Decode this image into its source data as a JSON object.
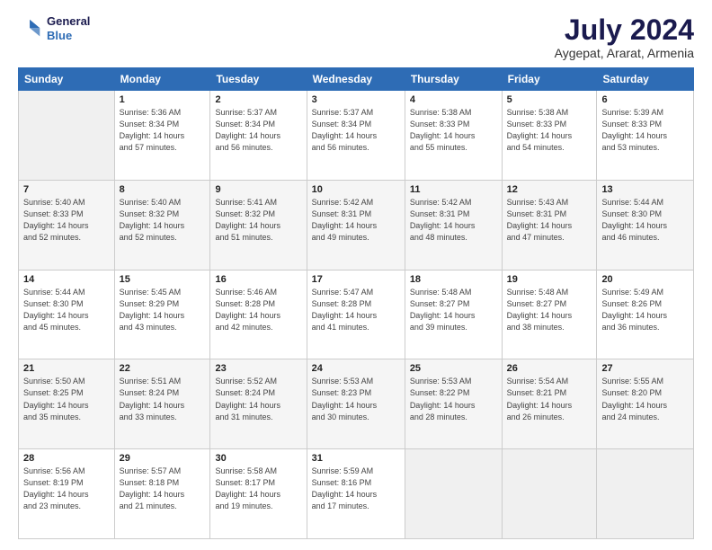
{
  "header": {
    "logo": {
      "line1": "General",
      "line2": "Blue"
    },
    "title": "July 2024",
    "subtitle": "Aygepat, Ararat, Armenia"
  },
  "calendar": {
    "days_of_week": [
      "Sunday",
      "Monday",
      "Tuesday",
      "Wednesday",
      "Thursday",
      "Friday",
      "Saturday"
    ],
    "weeks": [
      [
        {
          "num": "",
          "info": ""
        },
        {
          "num": "1",
          "info": "Sunrise: 5:36 AM\nSunset: 8:34 PM\nDaylight: 14 hours\nand 57 minutes."
        },
        {
          "num": "2",
          "info": "Sunrise: 5:37 AM\nSunset: 8:34 PM\nDaylight: 14 hours\nand 56 minutes."
        },
        {
          "num": "3",
          "info": "Sunrise: 5:37 AM\nSunset: 8:34 PM\nDaylight: 14 hours\nand 56 minutes."
        },
        {
          "num": "4",
          "info": "Sunrise: 5:38 AM\nSunset: 8:33 PM\nDaylight: 14 hours\nand 55 minutes."
        },
        {
          "num": "5",
          "info": "Sunrise: 5:38 AM\nSunset: 8:33 PM\nDaylight: 14 hours\nand 54 minutes."
        },
        {
          "num": "6",
          "info": "Sunrise: 5:39 AM\nSunset: 8:33 PM\nDaylight: 14 hours\nand 53 minutes."
        }
      ],
      [
        {
          "num": "7",
          "info": "Sunrise: 5:40 AM\nSunset: 8:33 PM\nDaylight: 14 hours\nand 52 minutes."
        },
        {
          "num": "8",
          "info": "Sunrise: 5:40 AM\nSunset: 8:32 PM\nDaylight: 14 hours\nand 52 minutes."
        },
        {
          "num": "9",
          "info": "Sunrise: 5:41 AM\nSunset: 8:32 PM\nDaylight: 14 hours\nand 51 minutes."
        },
        {
          "num": "10",
          "info": "Sunrise: 5:42 AM\nSunset: 8:31 PM\nDaylight: 14 hours\nand 49 minutes."
        },
        {
          "num": "11",
          "info": "Sunrise: 5:42 AM\nSunset: 8:31 PM\nDaylight: 14 hours\nand 48 minutes."
        },
        {
          "num": "12",
          "info": "Sunrise: 5:43 AM\nSunset: 8:31 PM\nDaylight: 14 hours\nand 47 minutes."
        },
        {
          "num": "13",
          "info": "Sunrise: 5:44 AM\nSunset: 8:30 PM\nDaylight: 14 hours\nand 46 minutes."
        }
      ],
      [
        {
          "num": "14",
          "info": "Sunrise: 5:44 AM\nSunset: 8:30 PM\nDaylight: 14 hours\nand 45 minutes."
        },
        {
          "num": "15",
          "info": "Sunrise: 5:45 AM\nSunset: 8:29 PM\nDaylight: 14 hours\nand 43 minutes."
        },
        {
          "num": "16",
          "info": "Sunrise: 5:46 AM\nSunset: 8:28 PM\nDaylight: 14 hours\nand 42 minutes."
        },
        {
          "num": "17",
          "info": "Sunrise: 5:47 AM\nSunset: 8:28 PM\nDaylight: 14 hours\nand 41 minutes."
        },
        {
          "num": "18",
          "info": "Sunrise: 5:48 AM\nSunset: 8:27 PM\nDaylight: 14 hours\nand 39 minutes."
        },
        {
          "num": "19",
          "info": "Sunrise: 5:48 AM\nSunset: 8:27 PM\nDaylight: 14 hours\nand 38 minutes."
        },
        {
          "num": "20",
          "info": "Sunrise: 5:49 AM\nSunset: 8:26 PM\nDaylight: 14 hours\nand 36 minutes."
        }
      ],
      [
        {
          "num": "21",
          "info": "Sunrise: 5:50 AM\nSunset: 8:25 PM\nDaylight: 14 hours\nand 35 minutes."
        },
        {
          "num": "22",
          "info": "Sunrise: 5:51 AM\nSunset: 8:24 PM\nDaylight: 14 hours\nand 33 minutes."
        },
        {
          "num": "23",
          "info": "Sunrise: 5:52 AM\nSunset: 8:24 PM\nDaylight: 14 hours\nand 31 minutes."
        },
        {
          "num": "24",
          "info": "Sunrise: 5:53 AM\nSunset: 8:23 PM\nDaylight: 14 hours\nand 30 minutes."
        },
        {
          "num": "25",
          "info": "Sunrise: 5:53 AM\nSunset: 8:22 PM\nDaylight: 14 hours\nand 28 minutes."
        },
        {
          "num": "26",
          "info": "Sunrise: 5:54 AM\nSunset: 8:21 PM\nDaylight: 14 hours\nand 26 minutes."
        },
        {
          "num": "27",
          "info": "Sunrise: 5:55 AM\nSunset: 8:20 PM\nDaylight: 14 hours\nand 24 minutes."
        }
      ],
      [
        {
          "num": "28",
          "info": "Sunrise: 5:56 AM\nSunset: 8:19 PM\nDaylight: 14 hours\nand 23 minutes."
        },
        {
          "num": "29",
          "info": "Sunrise: 5:57 AM\nSunset: 8:18 PM\nDaylight: 14 hours\nand 21 minutes."
        },
        {
          "num": "30",
          "info": "Sunrise: 5:58 AM\nSunset: 8:17 PM\nDaylight: 14 hours\nand 19 minutes."
        },
        {
          "num": "31",
          "info": "Sunrise: 5:59 AM\nSunset: 8:16 PM\nDaylight: 14 hours\nand 17 minutes."
        },
        {
          "num": "",
          "info": ""
        },
        {
          "num": "",
          "info": ""
        },
        {
          "num": "",
          "info": ""
        }
      ]
    ]
  }
}
